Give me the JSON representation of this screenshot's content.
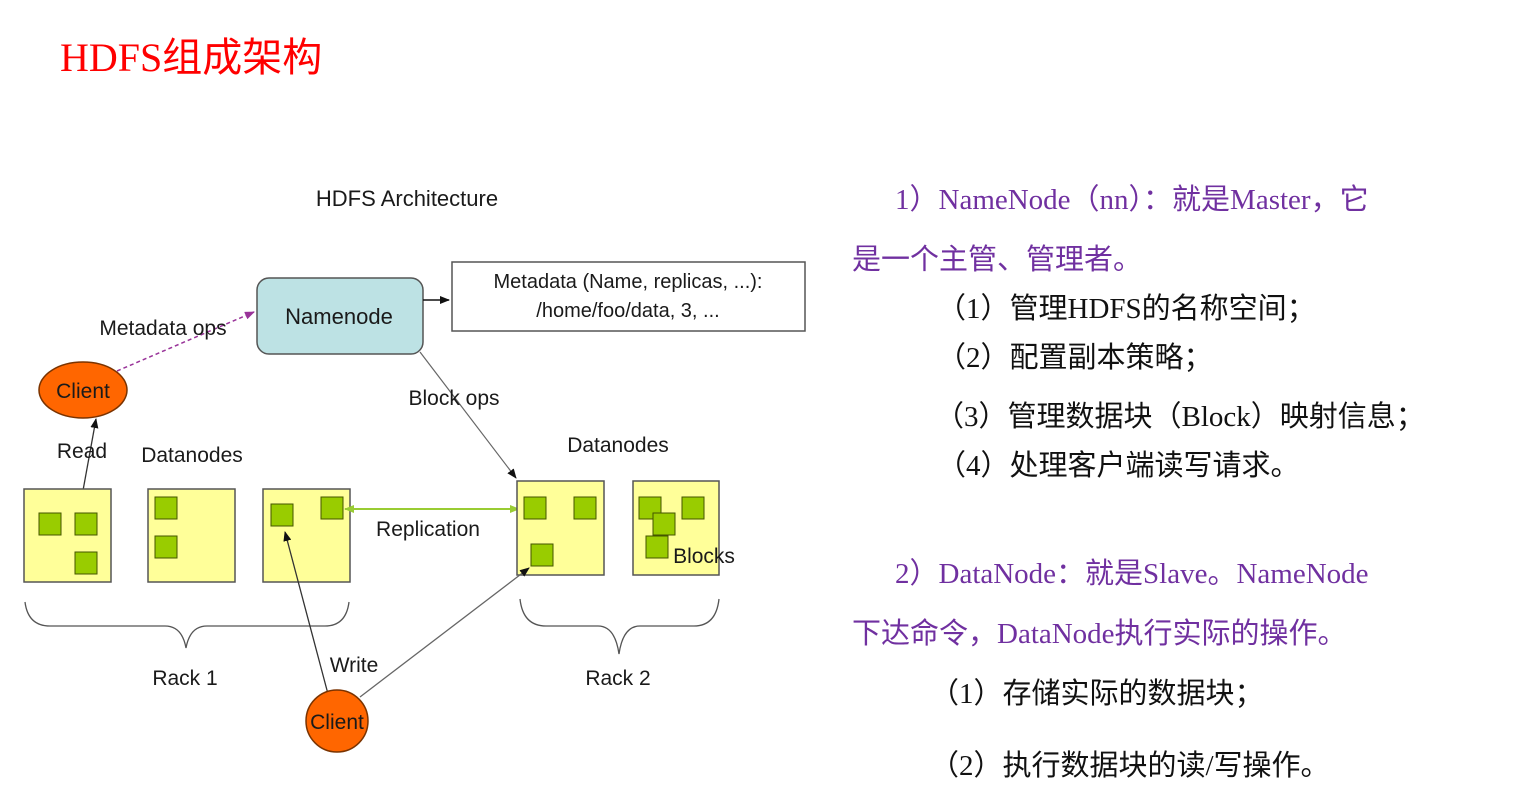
{
  "page": {
    "title": "HDFS组成架构"
  },
  "colors": {
    "title": "#ff0000",
    "heading_text": "#7030a0",
    "body_text": "#111111",
    "namenode_fill": "#bde2e4",
    "client_fill": "#ff6600",
    "datanode_fill": "#ffff99",
    "block_fill": "#99cc00",
    "metadata_arrow": "#993399",
    "replication_arrow": "#99cc33"
  },
  "diagram": {
    "title": "HDFS Architecture",
    "namenode_label": "Namenode",
    "metadata_box": {
      "line1": "Metadata (Name, replicas, ...):",
      "line2": "/home/foo/data, 3, ..."
    },
    "edge_labels": {
      "metadata_ops": "Metadata ops",
      "block_ops": "Block ops",
      "read": "Read",
      "write": "Write",
      "replication": "Replication",
      "blocks": "Blocks"
    },
    "client_top_label": "Client",
    "client_bottom_label": "Client",
    "rack1": {
      "heading": "Datanodes",
      "label": "Rack 1",
      "datanodes": [
        {
          "blocks": 3
        },
        {
          "blocks": 2
        },
        {
          "blocks": 2
        }
      ]
    },
    "rack2": {
      "heading": "Datanodes",
      "label": "Rack 2",
      "datanodes": [
        {
          "blocks": 3
        },
        {
          "blocks": 4
        }
      ]
    }
  },
  "description": {
    "namenode": {
      "heading_line1": "1）NameNode（nn）：就是Master，它",
      "heading_line2": "是一个主管、管理者。",
      "items": [
        "（1）管理HDFS的名称空间；",
        "（2）配置副本策略；",
        "（3）管理数据块（Block）映射信息；",
        "（4）处理客户端读写请求。"
      ]
    },
    "datanode": {
      "heading_line1": "2）DataNode：就是Slave。NameNode",
      "heading_line2": "下达命令，DataNode执行实际的操作。",
      "items": [
        "（1）存储实际的数据块；",
        "（2）执行数据块的读/写操作。"
      ]
    }
  }
}
